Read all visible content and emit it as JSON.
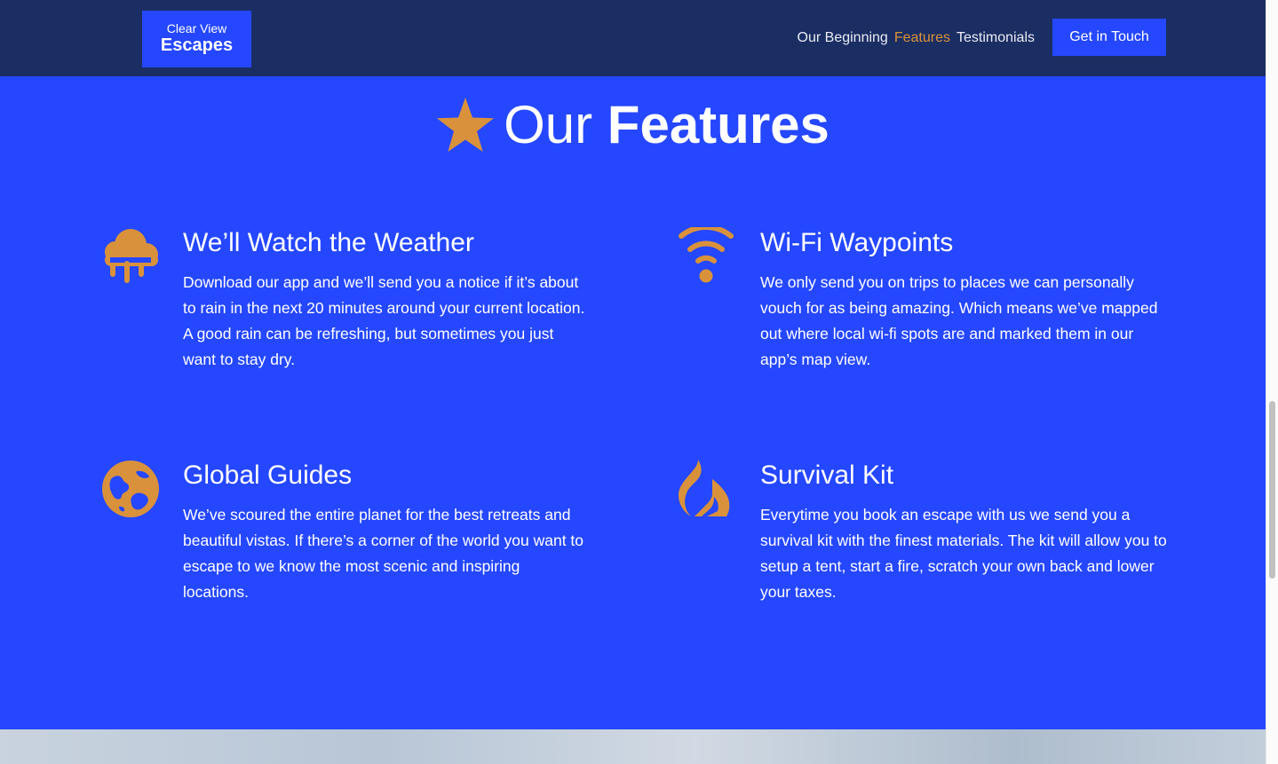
{
  "header": {
    "logo_line1": "Clear View",
    "logo_line2": "Escapes",
    "nav": [
      {
        "label": "Our Beginning",
        "active": false
      },
      {
        "label": "Features",
        "active": true
      },
      {
        "label": "Testimonials",
        "active": false
      }
    ],
    "cta_label": "Get in Touch"
  },
  "features_section": {
    "title_light": "Our",
    "title_bold": "Features",
    "title_icon": "star-icon",
    "items": [
      {
        "icon": "cloud-rain-icon",
        "title": "We’ll Watch the Weather",
        "description": "Download our app and we’ll send you a notice if it’s about to rain in the next 20 minutes around your current location. A good rain can be refreshing, but sometimes you just want to stay dry."
      },
      {
        "icon": "wifi-icon",
        "title": "Wi-Fi Waypoints",
        "description": "We only send you on trips to places we can personally vouch for as being amazing. Which means we’ve mapped out where local wi-fi spots are and marked them in our app’s map view."
      },
      {
        "icon": "globe-icon",
        "title": "Global Guides",
        "description": "We’ve scoured the entire planet for the best retreats and beautiful vistas. If there’s a corner of the world you want to escape to we know the most scenic and inspiring locations."
      },
      {
        "icon": "flame-icon",
        "title": "Survival Kit",
        "description": "Everytime you book an escape with us we send you a survival kit with the finest materials. The kit will allow you to setup a tent, start a fire, scratch your own back and lower your taxes."
      }
    ]
  },
  "colors": {
    "navbar_bg": "#1b2e63",
    "brand_blue": "#2547ff",
    "accent_orange": "#d9923b",
    "text_white": "#ffffff"
  }
}
